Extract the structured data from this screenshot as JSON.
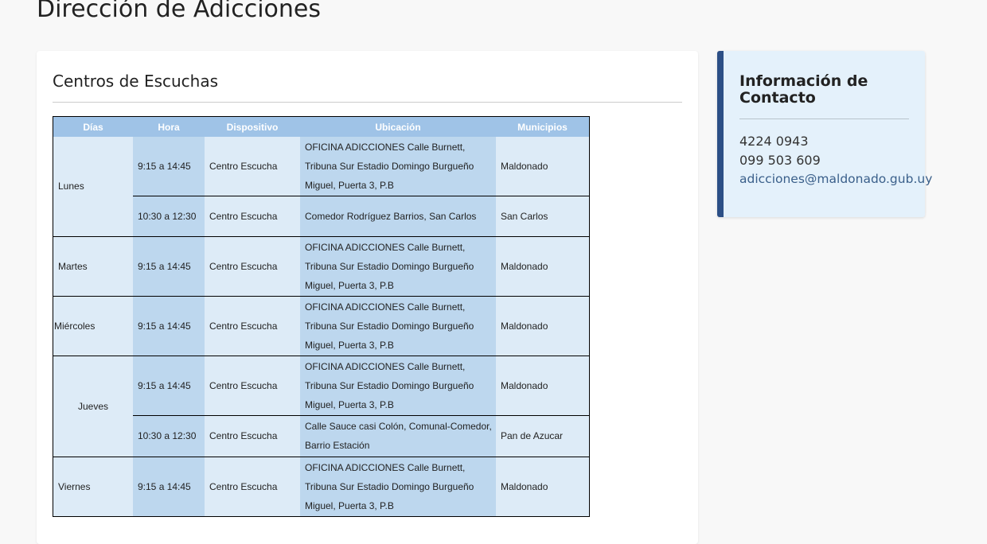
{
  "page": {
    "title": "Dirección de Adicciones"
  },
  "main": {
    "section_title": "Centros de Escuchas",
    "table": {
      "headers": [
        "Días",
        "Hora",
        "Dispositivo",
        "Ubicación",
        "Municipios"
      ],
      "days": {
        "lunes": "Lunes",
        "martes": "Martes",
        "miercoles": "Miércoles",
        "jueves": "Jueves",
        "viernes": "Viernes"
      },
      "rows": [
        {
          "hora": "9:15 a 14:45",
          "dispositivo": "Centro Escucha",
          "ubicacion": "OFICINA ADICCIONES Calle Burnett, Tribuna Sur Estadio Domingo Burgueño Miguel, Puerta 3, P.B",
          "municipio": "Maldonado"
        },
        {
          "hora": "10:30 a 12:30",
          "dispositivo": "Centro Escucha",
          "ubicacion": "Comedor Rodríguez Barrios, San Carlos",
          "municipio": "San Carlos"
        },
        {
          "hora": "9:15 a 14:45",
          "dispositivo": "Centro Escucha",
          "ubicacion": "OFICINA ADICCIONES Calle Burnett, Tribuna Sur Estadio Domingo Burgueño Miguel, Puerta 3, P.B",
          "municipio": "Maldonado"
        },
        {
          "hora": "9:15 a 14:45",
          "dispositivo": "Centro Escucha",
          "ubicacion": "OFICINA ADICCIONES Calle Burnett, Tribuna Sur Estadio Domingo Burgueño Miguel, Puerta 3, P.B",
          "municipio": "Maldonado"
        },
        {
          "hora": "9:15 a 14:45",
          "dispositivo": "Centro Escucha",
          "ubicacion": "OFICINA ADICCIONES Calle Burnett, Tribuna Sur Estadio Domingo Burgueño Miguel, Puerta 3, P.B",
          "municipio": "Maldonado"
        },
        {
          "hora": "10:30 a 12:30",
          "dispositivo": "Centro Escucha",
          "ubicacion": "Calle Sauce casi Colón, Comunal-Comedor, Barrio Estación",
          "municipio": "Pan de Azucar"
        },
        {
          "hora": "9:15 a 14:45",
          "dispositivo": "Centro Escucha",
          "ubicacion": "OFICINA ADICCIONES Calle Burnett, Tribuna Sur Estadio Domingo Burgueño Miguel, Puerta 3, P.B",
          "municipio": "Maldonado"
        }
      ]
    }
  },
  "contact": {
    "title": "Información de Contacto",
    "phone1": "4224 0943",
    "phone2": "099 503 609",
    "email": "adicciones@maldonado.gub.uy",
    "accent_color": "#2c4f86"
  }
}
